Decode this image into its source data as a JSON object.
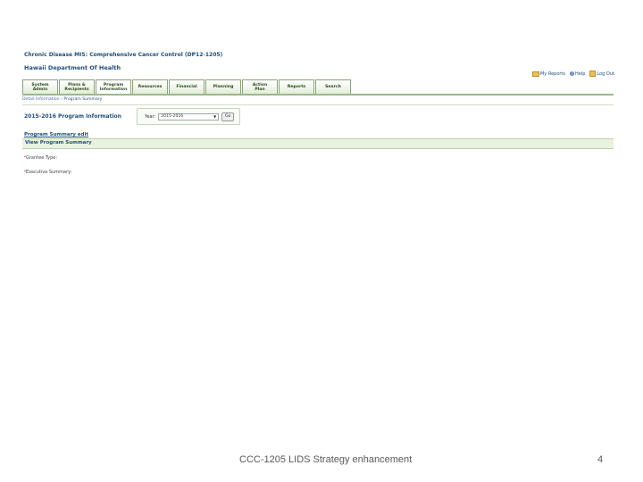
{
  "header": {
    "app_title": "Chronic Disease MIS: Comprehensive Cancer Control (DP12-1205)",
    "org_title": "Hawaii Department Of Health"
  },
  "util_links": {
    "my_reports": "My Reports",
    "help": "Help",
    "logout": "Log Out"
  },
  "tabs": [
    {
      "label": "System\nAdmin"
    },
    {
      "label": "Plans &\nRecipients"
    },
    {
      "label": "Program\nInformation"
    },
    {
      "label": "Resources"
    },
    {
      "label": "Financial"
    },
    {
      "label": "Planning"
    },
    {
      "label": "Action\nPlan"
    },
    {
      "label": "Reports"
    },
    {
      "label": "Search"
    }
  ],
  "breadcrumb": {
    "parent": "Detail Information",
    "separator": " › ",
    "current": "Program Summary"
  },
  "program": {
    "title": "2015-2016 Program Information",
    "year_label": "Year:",
    "year_value": "2015-2016",
    "go_label": "Go"
  },
  "summary": {
    "edit_link": "Program Summary edit",
    "view_title": "View Program Summary",
    "field_grantee": "Grantee Type:",
    "field_exec": "Executive Summary:",
    "required_mark": "*"
  },
  "footer": {
    "text": "CCC-1205 LIDS Strategy enhancement",
    "page_number": "4"
  }
}
